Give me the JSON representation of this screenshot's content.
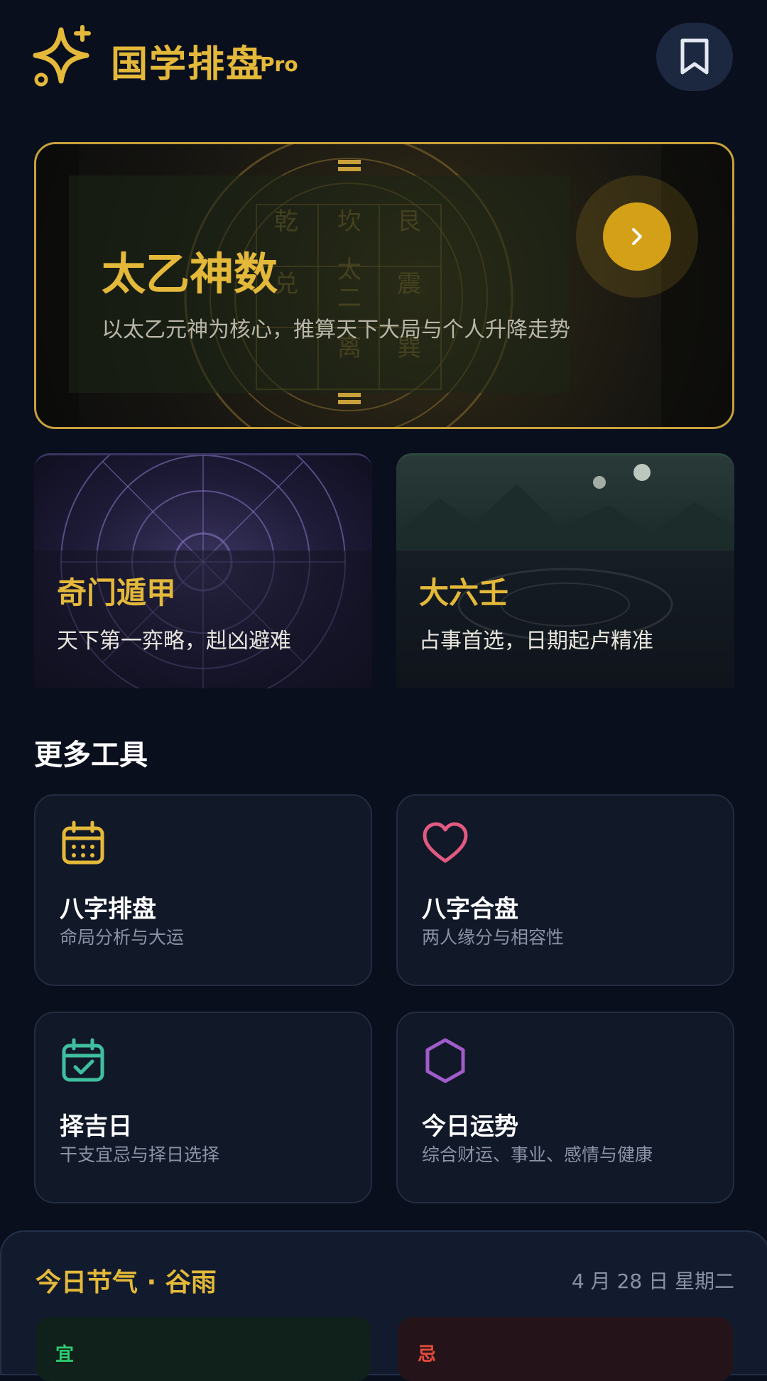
{
  "header": {
    "title": "国学排盘",
    "badge": "Pro",
    "logo_icon": "sparkle-icon",
    "bookmark_icon": "bookmark-icon"
  },
  "hero": {
    "title": "太乙神数",
    "subtitle": "以太乙元神为核心，推算天下大局与个人升降走势",
    "action_icon": "chevron-right-icon",
    "art_labels": [
      "乾",
      "坎",
      "艮",
      "兑",
      "太",
      "二",
      "震",
      "离",
      "巽"
    ]
  },
  "features": [
    {
      "title": "奇门遁甲",
      "subtitle": "天下第一弈略，赳凶避难"
    },
    {
      "title": "大六壬",
      "subtitle": "占事首选，日期起卢精准"
    }
  ],
  "more_tools": {
    "heading": "更多工具",
    "items": [
      {
        "name": "八字排盘",
        "desc": "命局分析与大运",
        "icon": "calendar-icon",
        "color": "#e4b93a"
      },
      {
        "name": "八字合盘",
        "desc": "两人缘分与相容性",
        "icon": "heart-icon",
        "color": "#e05a82"
      },
      {
        "name": "择吉日",
        "desc": "干支宜忌与择日选择",
        "icon": "calendar-check-icon",
        "color": "#3fbf9f"
      },
      {
        "name": "今日运势",
        "desc": "综合财运、事业、感情与健康",
        "icon": "hexagon-icon",
        "color": "#a05cc8"
      }
    ]
  },
  "today": {
    "title": "今日节气 · 谷雨",
    "date": "4 月 28 日  星期二",
    "yi_label": "宜",
    "ji_label": "忌"
  },
  "colors": {
    "accent": "#e4b93a",
    "background": "#0a0f1d",
    "card": "#111828"
  }
}
